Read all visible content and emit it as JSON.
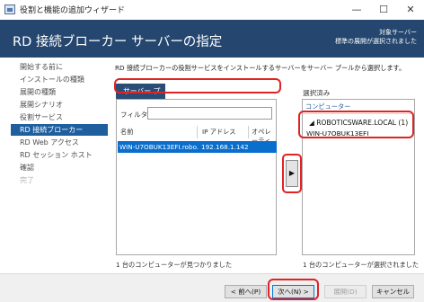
{
  "window": {
    "title": "役割と機能の追加ウィザード",
    "minimize_glyph": "—",
    "maximize_glyph": "☐",
    "close_glyph": "✕"
  },
  "header": {
    "title": "RD 接続ブローカー サーバーの指定",
    "destination_label": "対象サーバー",
    "destination_value": "標準の展開が選択されました",
    "background_color": "#25476f"
  },
  "nav": {
    "items": [
      {
        "label": "開始する前に",
        "state": "normal"
      },
      {
        "label": "インストールの種類",
        "state": "normal"
      },
      {
        "label": "展開の種類",
        "state": "normal"
      },
      {
        "label": "展開シナリオ",
        "state": "normal"
      },
      {
        "label": "役割サービス",
        "state": "normal"
      },
      {
        "label": "RD 接続ブローカー",
        "state": "active"
      },
      {
        "label": "RD Web アクセス",
        "state": "normal"
      },
      {
        "label": "RD セッション ホスト",
        "state": "normal"
      },
      {
        "label": "確認",
        "state": "normal"
      },
      {
        "label": "完了",
        "state": "disabled"
      }
    ]
  },
  "main": {
    "description": "RD 接続ブローカーの役割サービスをインストールするサーバーをサーバー プールから選択します。",
    "tab_label": "サーバー プール",
    "filter_label": "フィルター:",
    "filter_value": "",
    "columns": [
      "名前",
      "IP アドレス",
      "オペレーティ"
    ],
    "servers": [
      {
        "name": "WIN-U7OBUK13EFI.robo...",
        "ip": "192.168.1.142"
      }
    ],
    "found_count_text": "1 台のコンピューターが見つかりました",
    "add_button_glyph": "▶",
    "selected_label": "選択済み",
    "selected_column": "コンピューター",
    "selected_group": "◢ ROBOTICSWARE.LOCAL (1)",
    "selected_server": "WIN-U7OBUK13EFI",
    "selected_count_text": "1 台のコンピューターが選択されました"
  },
  "footer": {
    "prev_label": "< 前へ(P)",
    "next_label": "次へ(N) >",
    "install_label": "展開(D)",
    "cancel_label": "キャンセル"
  },
  "colors": {
    "accent": "#1f5f9e",
    "selection": "#0a6ecc",
    "highlight_annotation": "#e02323"
  }
}
